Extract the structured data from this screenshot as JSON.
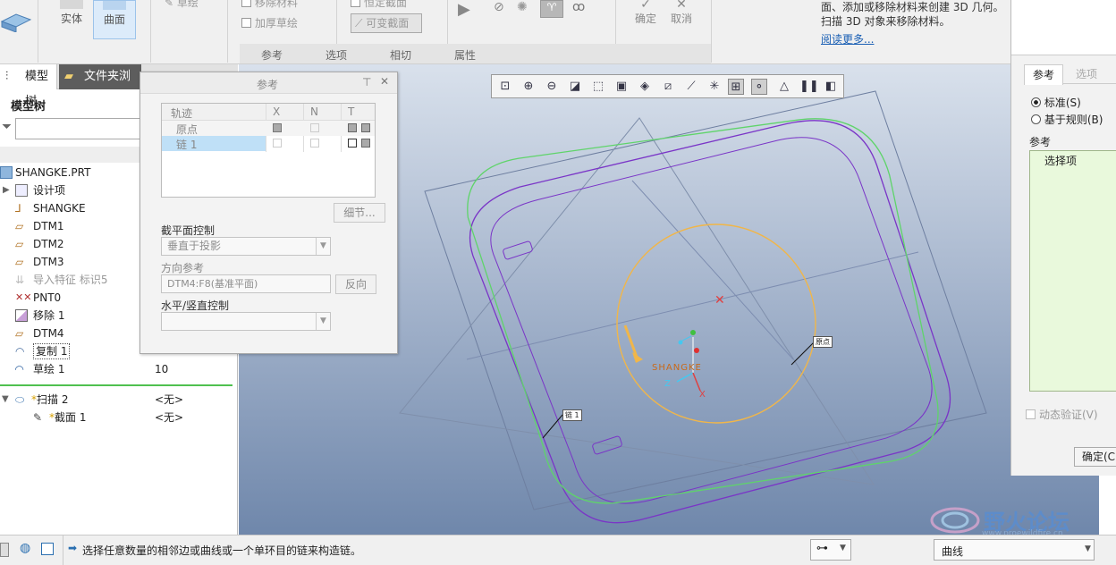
{
  "ribbon": {
    "solid": "实体",
    "surface": "曲面",
    "sketch": "草绘",
    "remove_material": "移除材料",
    "thicken_sketch": "加厚草绘",
    "constant_section": "恒定截面",
    "variable_section": "可变截面",
    "confirm": "确定",
    "cancel": "取消",
    "groups": [
      "参考",
      "选项",
      "相切",
      "属性"
    ]
  },
  "help": {
    "line1": "面、添加或移除材料来创建 3D 几何。",
    "line2": "扫描 3D 对象来移除材料。",
    "read_more": "阅读更多..."
  },
  "left_tabs": {
    "model_tree": "模型树",
    "folder_browser": "文件夹浏览"
  },
  "tree": {
    "heading": "模型树",
    "root": "SHANGKE.PRT",
    "items": [
      {
        "label": "设计项",
        "value": ""
      },
      {
        "label": "SHANGKE",
        "value": ""
      },
      {
        "label": "DTM1",
        "value": ""
      },
      {
        "label": "DTM2",
        "value": ""
      },
      {
        "label": "DTM3",
        "value": ""
      },
      {
        "label": "导入特征 标识5",
        "value": ""
      },
      {
        "label": "PNT0",
        "value": ""
      },
      {
        "label": "移除 1",
        "value": ""
      },
      {
        "label": "DTM4",
        "value": ""
      },
      {
        "label": "复制 1",
        "value": ""
      },
      {
        "label": "草绘 1",
        "value": "10"
      }
    ],
    "sweep": {
      "label": "扫描 2",
      "value": "<无>"
    },
    "section": {
      "label": "截面 1",
      "value": "<无>"
    }
  },
  "ref_dialog": {
    "title": "参考",
    "table_headers": [
      "轨迹",
      "X",
      "N",
      "T"
    ],
    "rows": [
      "原点",
      "链 1"
    ],
    "details_btn": "细节...",
    "section_plane_label": "截平面控制",
    "section_plane_value": "垂直于投影",
    "direction_label": "方向参考",
    "direction_value": "DTM4:F8(基准平面)",
    "flip_btn": "反向",
    "hv_label": "水平/竖直控制"
  },
  "viewport": {
    "csys_label": "SHANGKE",
    "axis_x": "X",
    "axis_z": "Z",
    "tag1": "链 1",
    "tag2": "原点"
  },
  "right_panel": {
    "tab_ref": "参考",
    "tab_options": "选项",
    "radio_standard": "标准(S)",
    "radio_rule": "基于规则(B)",
    "ref_label": "参考",
    "select_item": "选择项",
    "dynamic_check": "动态验证(V)",
    "ok_btn": "确定(C"
  },
  "status": {
    "message": "选择任意数量的相邻边或曲线或一个单环目的链来构造链。",
    "filter_value": "曲线"
  },
  "watermark": {
    "text": "野火论坛",
    "url": "www.proewildfire.cn"
  },
  "colors": {
    "accent": "#3a7bd5",
    "green_curve": "#5fd46a",
    "purple_curve": "#7a35c7",
    "orange_curve": "#f0b64a"
  }
}
